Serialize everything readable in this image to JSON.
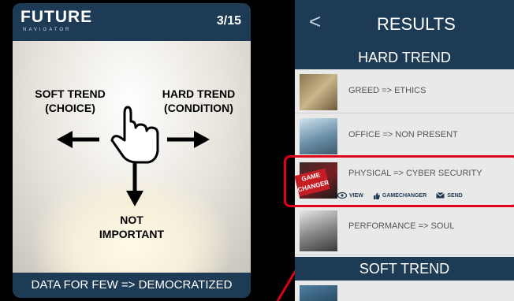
{
  "left": {
    "logo": "FUTURE",
    "logo_sub": "NAVIGATOR",
    "counter": "3/15",
    "labels": {
      "soft": "SOFT TREND\n(CHOICE)",
      "hard": "HARD TREND\n(CONDITION)",
      "not": "NOT\nIMPORTANT"
    },
    "footer": "DATA FOR FEW => DEMOCRATIZED"
  },
  "right": {
    "back": "<",
    "title": "RESULTS",
    "sections": {
      "hard": "HARD TREND",
      "soft": "SOFT TREND"
    },
    "rows": [
      {
        "label": "GREED => ETHICS"
      },
      {
        "label": "OFFICE => NON PRESENT"
      },
      {
        "label": "PHYSICAL => CYBER SECURITY",
        "badge": "GAME CHANGER",
        "actions": {
          "view": "VIEW",
          "gamechanger": "GAMECHANGER",
          "send": "SEND"
        }
      },
      {
        "label": "PERFORMANCE => SOUL"
      }
    ]
  },
  "colors": {
    "navy": "#1e3b56",
    "highlight": "#e0001a",
    "badge": "#c51d24"
  }
}
